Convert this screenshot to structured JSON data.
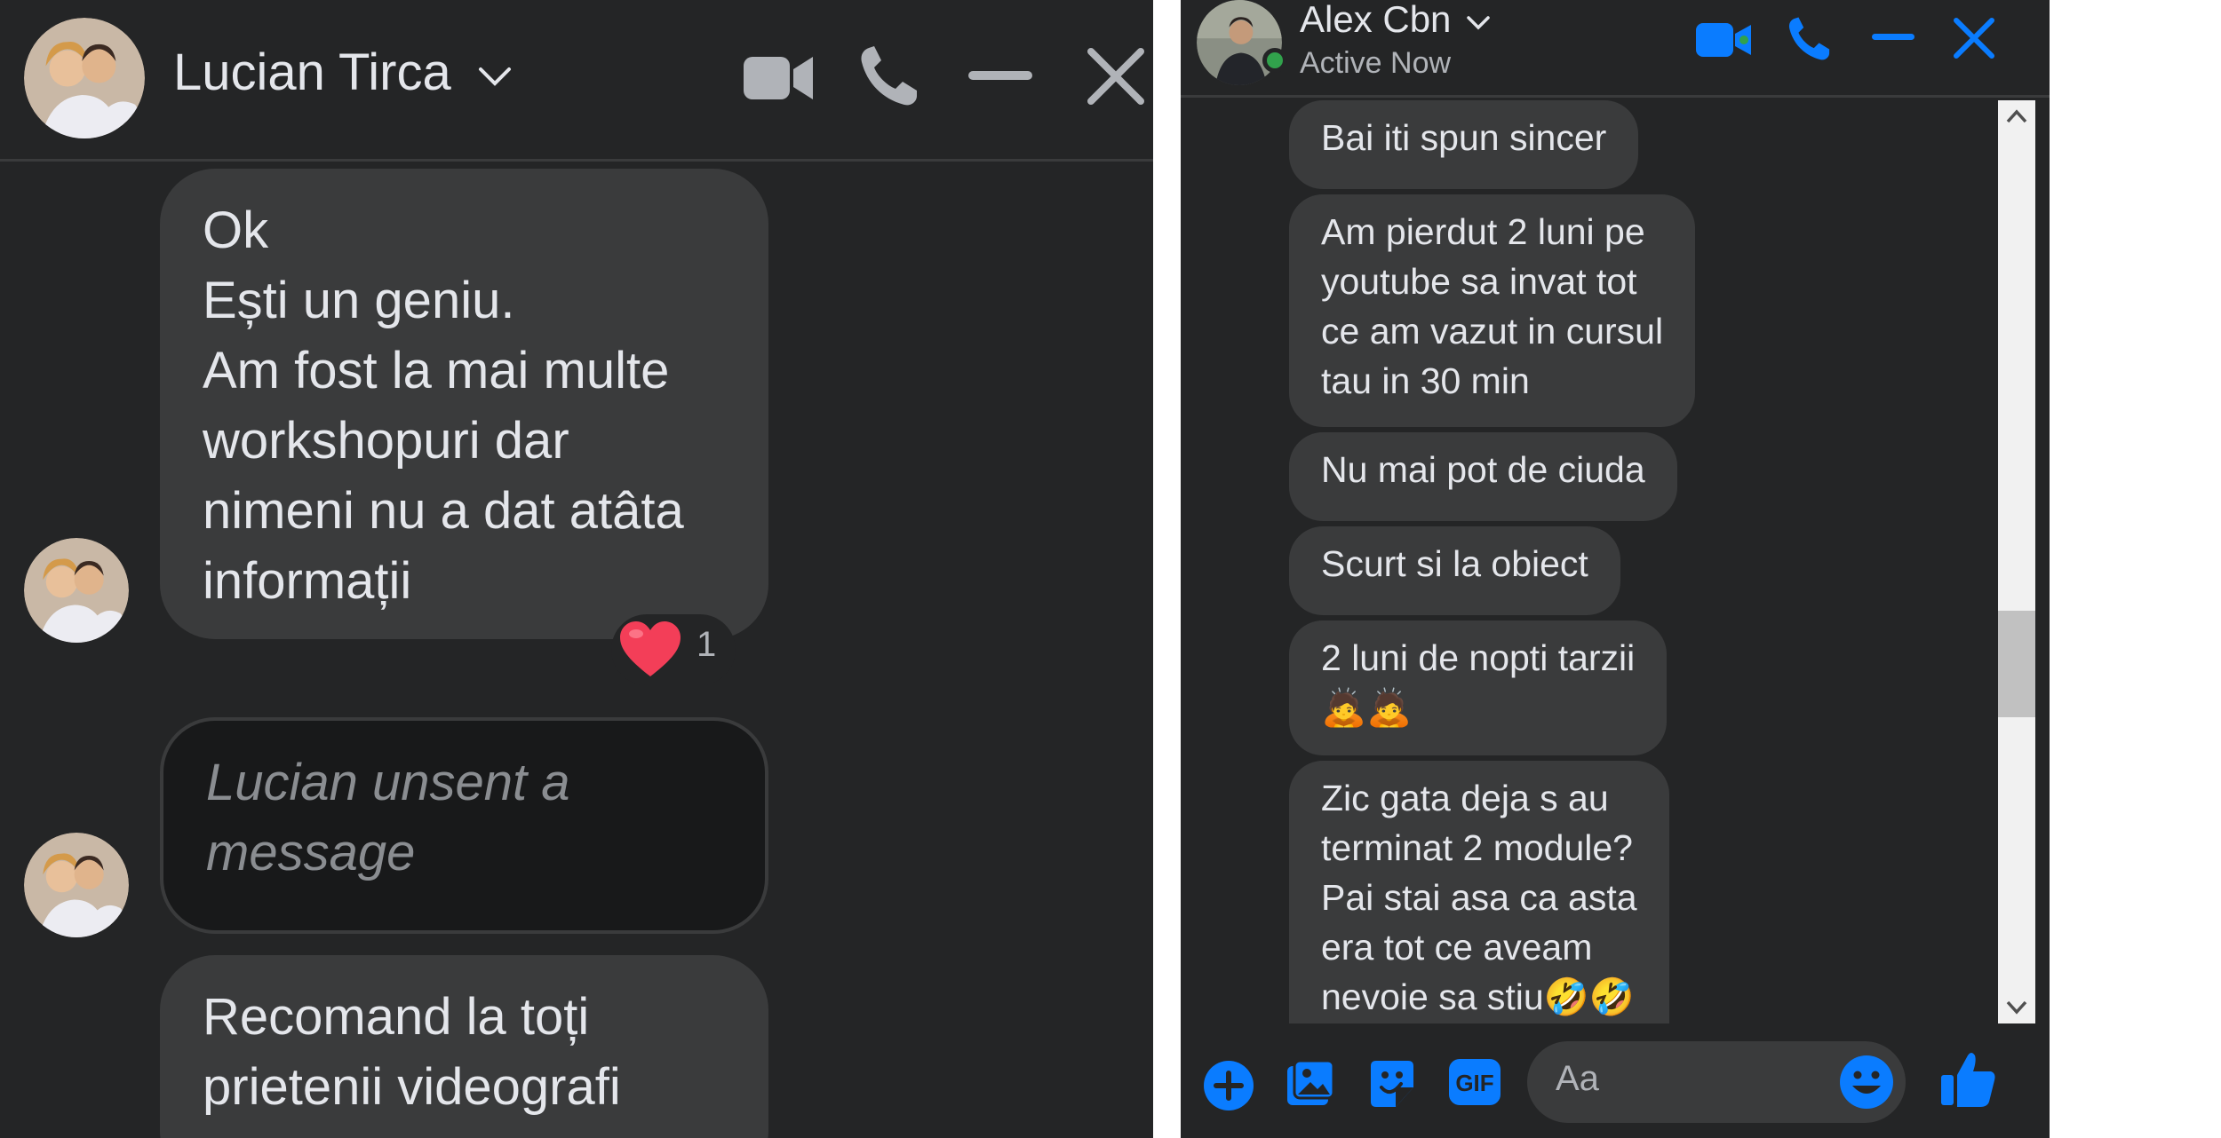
{
  "left_chat": {
    "contact_name": "Lucian Tirca",
    "messages": [
      {
        "lines": [
          "Ok",
          "Ești un geniu.",
          "Am fost la mai multe",
          "workshopuri dar",
          "nimeni nu a dat atâta",
          "informații"
        ],
        "reaction": {
          "emoji": "heart",
          "count": "1"
        }
      },
      {
        "lines": [
          "Lucian unsent a",
          "message"
        ]
      },
      {
        "lines": [
          "Recomand la toți",
          "prietenii videografi"
        ]
      }
    ]
  },
  "right_chat": {
    "contact_name": "Alex Cbn",
    "status": "Active Now",
    "messages": [
      {
        "lines": [
          "Bai iti spun sincer"
        ]
      },
      {
        "lines": [
          "Am pierdut 2 luni pe",
          "youtube sa invat tot",
          "ce am vazut in cursul",
          "tau in 30 min"
        ]
      },
      {
        "lines": [
          "Nu mai pot de ciuda"
        ]
      },
      {
        "lines": [
          "Scurt si la obiect"
        ]
      },
      {
        "lines": [
          "2 luni de nopti tarzii",
          "🙇🙇"
        ]
      },
      {
        "lines": [
          "Zic gata deja s au",
          "terminat 2 module?",
          "Pai stai asa ca asta",
          "era tot ce aveam",
          "nevoie sa stiu🤣🤣"
        ]
      }
    ],
    "composer_placeholder": "Aa"
  },
  "colors": {
    "background": "#242526",
    "bubble": "#3a3b3c",
    "text": "#e4e6eb",
    "accent_blue": "#0a7cff",
    "active_green": "#31a24c",
    "heart_red": "#f33e58"
  },
  "icons": {
    "left_header": [
      "video-camera-icon",
      "phone-icon",
      "minimize-icon",
      "close-icon"
    ],
    "right_header": [
      "video-camera-icon",
      "phone-icon",
      "minimize-icon",
      "close-icon"
    ],
    "composer": [
      "plus-icon",
      "photo-icon",
      "sticker-icon",
      "gif-icon",
      "emoji-icon",
      "thumbs-up-icon"
    ]
  }
}
